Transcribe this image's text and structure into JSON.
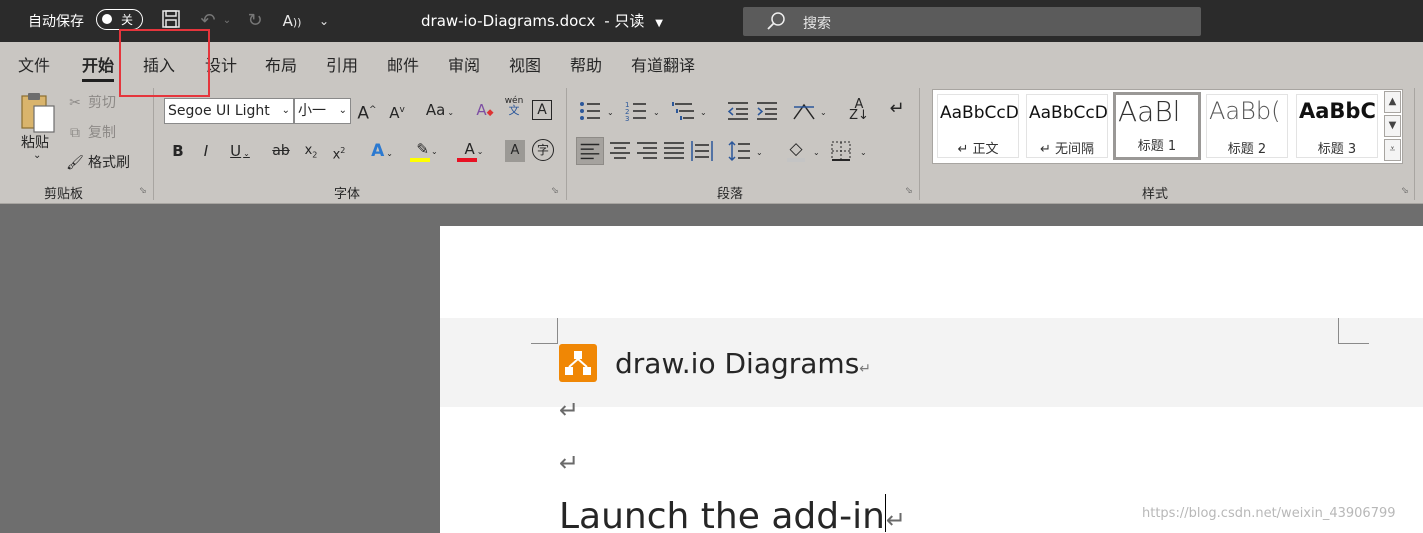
{
  "titlebar": {
    "autosave_label": "自动保存",
    "autosave_state": "关",
    "document_title": "draw-io-Diagrams.docx",
    "mode": "只读",
    "search_placeholder": "搜索"
  },
  "tabs": [
    "文件",
    "开始",
    "插入",
    "设计",
    "布局",
    "引用",
    "邮件",
    "审阅",
    "视图",
    "帮助",
    "有道翻译"
  ],
  "active_tab": "开始",
  "clipboard": {
    "paste": "粘贴",
    "cut": "剪切",
    "copy": "复制",
    "format_painter": "格式刷",
    "group_label": "剪贴板"
  },
  "font": {
    "font_name": "Segoe UI Light",
    "font_size": "小一",
    "case_label": "Aa",
    "phonetic_top": "wén",
    "phonetic_bottom": "文",
    "border_char": "A",
    "enclose_char": "字",
    "group_label": "字体"
  },
  "paragraph": {
    "group_label": "段落"
  },
  "styles": {
    "items": [
      {
        "preview": "AaBbCcD",
        "name": "↵ 正文"
      },
      {
        "preview": "AaBbCcD",
        "name": "↵ 无间隔"
      },
      {
        "preview": "AaBl",
        "name": "标题 1"
      },
      {
        "preview": "AaBb(",
        "name": "标题 2"
      },
      {
        "preview": "AaBbC",
        "name": "标题 3"
      }
    ],
    "group_label": "样式"
  },
  "document": {
    "heading": "draw.io Diagrams",
    "h1": "Launch the add-in",
    "paragraph_mark": "↵"
  },
  "watermark": "https://blog.csdn.net/weixin_43906799",
  "colors": {
    "highlight_box": "#e5353c",
    "drawio_orange": "#f08705",
    "highlight_yellow": "#ffff00",
    "font_red": "#e81123"
  }
}
